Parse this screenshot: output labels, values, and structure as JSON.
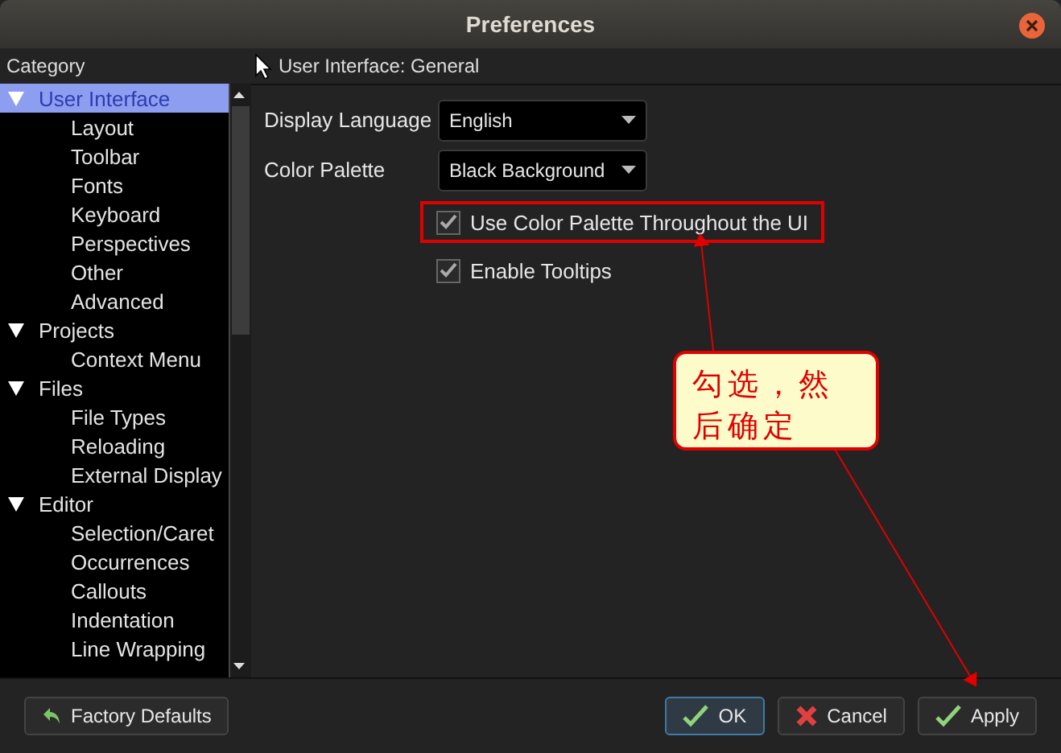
{
  "window": {
    "title": "Preferences"
  },
  "sidebar": {
    "header": "Category",
    "tree": [
      {
        "label": "User Interface",
        "expanded": true,
        "selected": true,
        "children": [
          {
            "label": "Layout",
            "selected": false
          },
          {
            "label": "Toolbar",
            "selected": false
          },
          {
            "label": "Fonts",
            "selected": false
          },
          {
            "label": "Keyboard",
            "selected": false
          },
          {
            "label": "Perspectives",
            "selected": false
          },
          {
            "label": "Other",
            "selected": false
          },
          {
            "label": "Advanced",
            "selected": false
          }
        ]
      },
      {
        "label": "Projects",
        "expanded": true,
        "selected": false,
        "children": [
          {
            "label": "Context Menu",
            "selected": false
          }
        ]
      },
      {
        "label": "Files",
        "expanded": true,
        "selected": false,
        "children": [
          {
            "label": "File Types",
            "selected": false
          },
          {
            "label": "Reloading",
            "selected": false
          },
          {
            "label": "External Display",
            "selected": false
          }
        ]
      },
      {
        "label": "Editor",
        "expanded": true,
        "selected": false,
        "children": [
          {
            "label": "Selection/Caret",
            "selected": false
          },
          {
            "label": "Occurrences",
            "selected": false
          },
          {
            "label": "Callouts",
            "selected": false
          },
          {
            "label": "Indentation",
            "selected": false
          },
          {
            "label": "Line Wrapping",
            "selected": false
          }
        ]
      }
    ]
  },
  "panel": {
    "title": "User Interface: General",
    "fields": [
      {
        "label": "Display Language",
        "value": "English"
      },
      {
        "label": "Color Palette",
        "value": "Black Background"
      }
    ],
    "checkboxes": [
      {
        "label": "Use Color Palette Throughout the UI",
        "checked": true,
        "highlighted": true
      },
      {
        "label": "Enable Tooltips",
        "checked": true,
        "highlighted": false
      }
    ]
  },
  "buttons": [
    {
      "label": "Factory Defaults",
      "kind": "revert",
      "focused": false
    },
    {
      "label": "OK",
      "kind": "confirm",
      "focused": true
    },
    {
      "label": "Cancel",
      "kind": "cancel",
      "focused": false
    },
    {
      "label": "Apply",
      "kind": "confirm",
      "focused": false
    }
  ],
  "annotation": {
    "text": "勾选，然后确定"
  }
}
